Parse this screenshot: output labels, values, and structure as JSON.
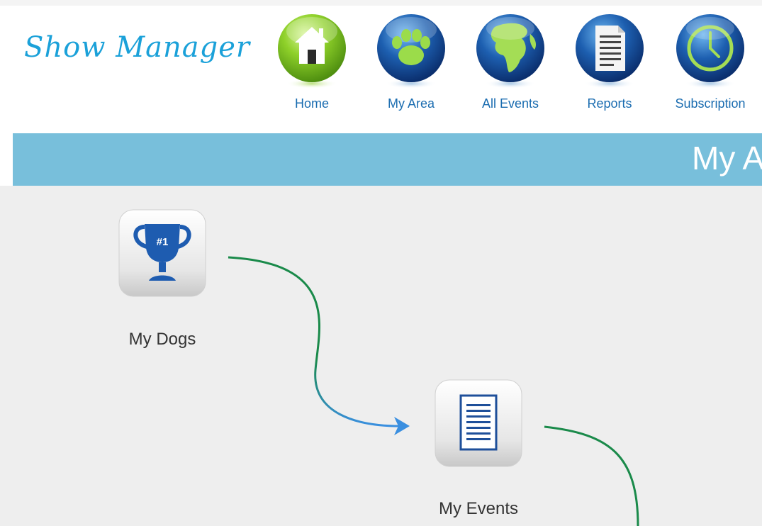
{
  "app": {
    "logo_text": "Show Manager"
  },
  "nav": [
    {
      "label": "Home",
      "icon": "home-icon",
      "color": "#7dc424"
    },
    {
      "label": "My Area",
      "icon": "paw-icon",
      "color": "#1c5aa8"
    },
    {
      "label": "All Events",
      "icon": "globe-icon",
      "color": "#1c5aa8"
    },
    {
      "label": "Reports",
      "icon": "document-icon",
      "color": "#1c5aa8"
    },
    {
      "label": "Subscription",
      "icon": "clock-icon",
      "color": "#1c5aa8"
    }
  ],
  "page": {
    "title": "My A"
  },
  "tiles": [
    {
      "label": "My Dogs",
      "icon": "trophy-icon",
      "badge": "#1"
    },
    {
      "label": "My Events",
      "icon": "document-icon"
    }
  ],
  "colors": {
    "title_band": "#78bfdb",
    "flow_line": "#1a8a4a",
    "flow_arrow": "#3a8fe0",
    "nav_label": "#1a6cb0",
    "logo": "#1ba1d9"
  }
}
